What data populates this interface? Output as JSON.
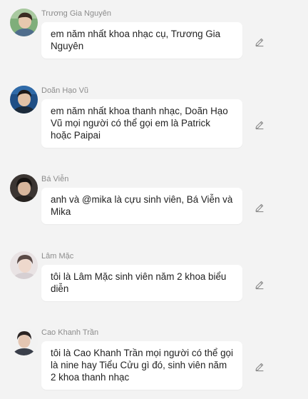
{
  "messages": [
    {
      "author": "Trương Gia Nguyên",
      "text": "em năm nhất khoa nhạc cụ, Trương Gia Nguyên",
      "avatar": "portrait-photo-green-bg",
      "action_icon": "pencil-icon"
    },
    {
      "author": "Doãn Hạo Vũ",
      "text": "em năm nhất khoa thanh nhạc, Doãn Hạo Vũ mọi người có thể gọi em là Patrick hoặc Paipai",
      "avatar": "portrait-photo-blue-bg",
      "action_icon": "pencil-icon"
    },
    {
      "author": "Bá Viễn",
      "text": "anh và @mika là cựu sinh viên, Bá Viễn và Mika",
      "avatar": "portrait-photo-dark-bg",
      "action_icon": "pencil-icon"
    },
    {
      "author": "Lâm Mặc",
      "text": "tôi là Lâm Mặc sinh viên năm 2 khoa biểu diễn",
      "avatar": "portrait-photo-light-bg",
      "action_icon": "pencil-icon"
    },
    {
      "author": "Cao Khanh Trần",
      "text": "tôi là Cao Khanh Trần mọi người có thể gọi là nine hay Tiểu Cửu gì đó, sinh viên năm 2 khoa thanh nhạc",
      "avatar": "portrait-photo-white-bg",
      "action_icon": "pencil-icon"
    }
  ],
  "colors": {
    "background": "#f3f3f3",
    "bubble": "#ffffff",
    "author_name": "#8c8c8c",
    "message_text": "#222222",
    "icon": "#8a8a8a"
  }
}
